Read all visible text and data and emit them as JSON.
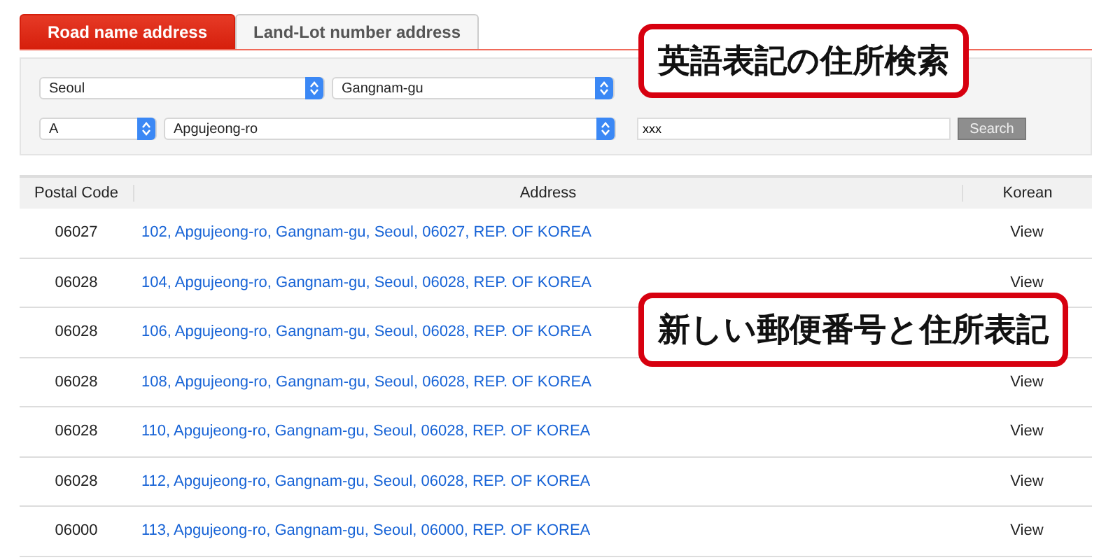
{
  "tabs": [
    {
      "label": "Road name address",
      "selected": true
    },
    {
      "label": "Land-Lot number address",
      "selected": false
    }
  ],
  "search": {
    "selects_row_1": [
      {
        "value": "Seoul"
      },
      {
        "value": "Gangnam-gu"
      }
    ],
    "selects_row_2": [
      {
        "value": "A"
      },
      {
        "value": "Apgujeong-ro"
      }
    ],
    "query": "xxx",
    "button": "Search"
  },
  "table": {
    "columns": [
      "Postal Code",
      "Address",
      "Korean"
    ],
    "rows": [
      {
        "postal_code": "06027",
        "address": "102, Apgujeong-ro, Gangnam-gu, Seoul, 06027, REP. OF KOREA",
        "korean": "View"
      },
      {
        "postal_code": "06028",
        "address": "104, Apgujeong-ro, Gangnam-gu, Seoul, 06028, REP. OF KOREA",
        "korean": "View"
      },
      {
        "postal_code": "06028",
        "address": "106, Apgujeong-ro, Gangnam-gu, Seoul, 06028, REP. OF KOREA"
      },
      {
        "postal_code": "06028",
        "address": "108, Apgujeong-ro, Gangnam-gu, Seoul, 06028, REP. OF KOREA",
        "korean": "View"
      },
      {
        "postal_code": "06028",
        "address": "110, Apgujeong-ro, Gangnam-gu, Seoul, 06028, REP. OF KOREA",
        "korean": "View"
      },
      {
        "postal_code": "06028",
        "address": "112, Apgujeong-ro, Gangnam-gu, Seoul, 06028, REP. OF KOREA",
        "korean": "View"
      },
      {
        "postal_code": "06000",
        "address": "113, Apgujeong-ro, Gangnam-gu, Seoul, 06000, REP. OF KOREA",
        "korean": "View"
      }
    ]
  },
  "callouts": [
    "英語表記の住所検索",
    "新しい郵便番号と住所表記"
  ]
}
